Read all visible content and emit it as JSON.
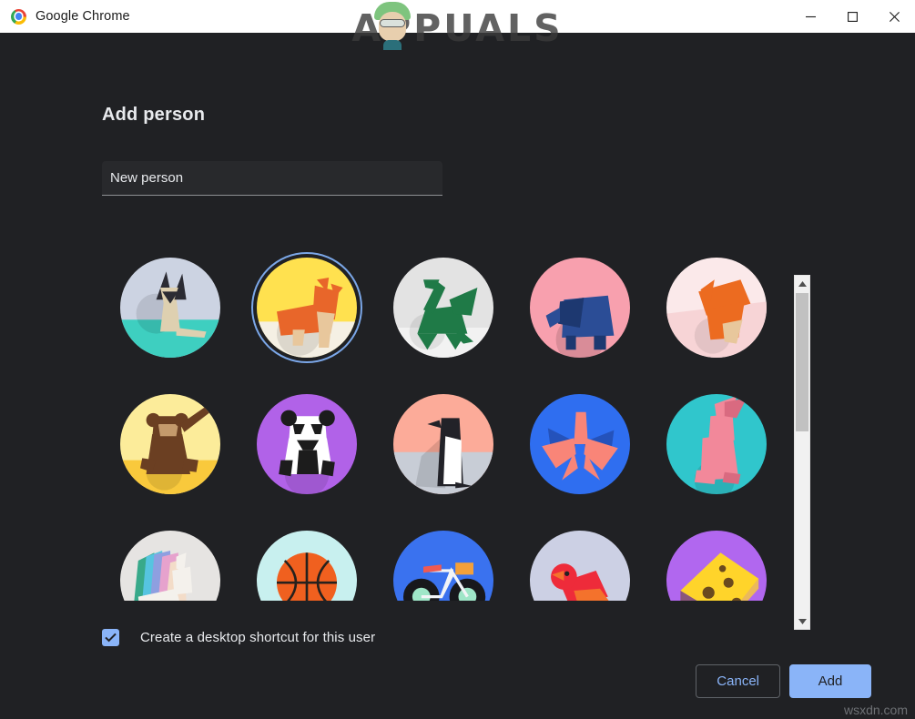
{
  "window": {
    "title": "Google Chrome",
    "logo_icon": "chrome-logo-icon",
    "controls": {
      "minimize": "minimize-icon",
      "maximize": "maximize-icon",
      "close": "close-icon"
    }
  },
  "watermark": {
    "brand": "APPUALS",
    "corner": "wsxdn.com"
  },
  "dialog": {
    "title": "Add person",
    "name_input": {
      "value": "New person",
      "placeholder": "New person"
    },
    "checkbox": {
      "label": "Create a desktop shortcut for this user",
      "checked": true
    },
    "buttons": {
      "cancel": "Cancel",
      "add": "Add"
    }
  },
  "colors": {
    "background": "#202124",
    "titlebar": "#ffffff",
    "text_primary": "#e8eaed",
    "accent": "#8ab4f8",
    "selection_ring": "#7ba7e8",
    "input_background": "#28292c",
    "scrollbar_track": "#f1f1f1",
    "scrollbar_thumb": "#c1c1c1"
  },
  "avatars": {
    "selected_index": 1,
    "items": [
      {
        "name": "cat",
        "bg": "#ccd3e2",
        "ground": "#3ecfc0",
        "subject": "#ded0b0",
        "accent": "#2b2b33"
      },
      {
        "name": "dog",
        "bg": "#ffe14f",
        "ground": "#f5f0e4",
        "subject": "#e8662a",
        "accent": "#e8c79c"
      },
      {
        "name": "dragon",
        "bg": "#e3e3e3",
        "ground": "#f2f2f2",
        "subject": "#1f7a47",
        "accent": "#12histo"
      },
      {
        "name": "elephant",
        "bg": "#f8a0ae",
        "ground": "#f8a0ae",
        "subject": "#2b4d96",
        "accent": "#1d3870"
      },
      {
        "name": "fox",
        "bg": "#fbe9ea",
        "ground": "#f7d4d6",
        "subject": "#ec6b20",
        "accent": "#e8c79c"
      },
      {
        "name": "monkey",
        "bg": "#fcec9a",
        "ground": "#f9c93c",
        "subject": "#6b3f22",
        "accent": "#c49a6c"
      },
      {
        "name": "panda",
        "bg": "#b162e8",
        "ground": "#b162e8",
        "subject": "#ffffff",
        "accent": "#1c1c1c"
      },
      {
        "name": "penguin",
        "bg": "#fcab99",
        "ground": "#c8cdd6",
        "subject": "#ffffff",
        "accent": "#222228"
      },
      {
        "name": "butterfly",
        "bg": "#2f6ef0",
        "ground": "#2f6ef0",
        "subject": "#f98578",
        "accent": "#2452bb"
      },
      {
        "name": "rabbit",
        "bg": "#30c6cc",
        "ground": "#30c6cc",
        "subject": "#f2889a",
        "accent": "#d96a80"
      },
      {
        "name": "unicorn",
        "bg": "#e6e4e2",
        "ground": "#dcdde2",
        "subject": "#f4f1ec",
        "accent": "#38a98a"
      },
      {
        "name": "basketball",
        "bg": "#c8f0ef",
        "ground": "#c8f0ef",
        "subject": "#f0601f",
        "accent": "#26211d"
      },
      {
        "name": "bicycle",
        "bg": "#3a72ef",
        "ground": "#3a72ef",
        "subject": "#f2f4f7",
        "accent": "#18181c"
      },
      {
        "name": "bird",
        "bg": "#ccd0e4",
        "ground": "#ccd0e4",
        "subject": "#ee2b3a",
        "accent": "#f4722c"
      },
      {
        "name": "cheese",
        "bg": "#b167ef",
        "ground": "#b167ef",
        "subject": "#ffd42a",
        "accent": "#6b4a1e"
      }
    ]
  },
  "scrollbar": {
    "up_arrow": "scroll-up-icon",
    "down_arrow": "scroll-down-icon"
  }
}
